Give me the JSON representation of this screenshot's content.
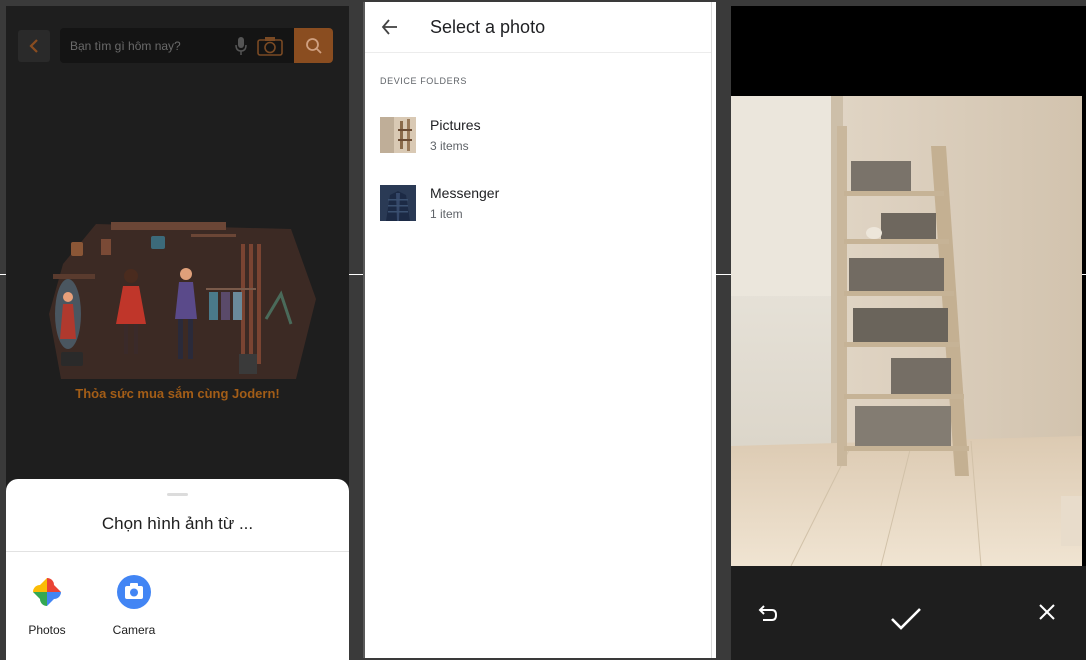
{
  "panel1": {
    "search_placeholder": "Bạn tìm gì hôm nay?",
    "slogan": "Thỏa sức mua sắm cùng Jodern!",
    "sheet_title": "Chọn hình ảnh từ ...",
    "apps": [
      {
        "label": "Photos",
        "icon": "google-photos-icon"
      },
      {
        "label": "Camera",
        "icon": "camera-app-icon"
      }
    ],
    "icons": [
      "chevron-left-icon",
      "mic-icon",
      "camera-icon",
      "search-icon"
    ],
    "accent": "#8a4d20"
  },
  "panel2": {
    "title": "Select a photo",
    "section": "DEVICE FOLDERS",
    "folders": [
      {
        "name": "Pictures",
        "count": "3 items"
      },
      {
        "name": "Messenger",
        "count": "1 item"
      }
    ],
    "icons": [
      "back-arrow-icon"
    ]
  },
  "panel3": {
    "icons": [
      "rotate-icon",
      "check-icon",
      "close-icon"
    ]
  }
}
